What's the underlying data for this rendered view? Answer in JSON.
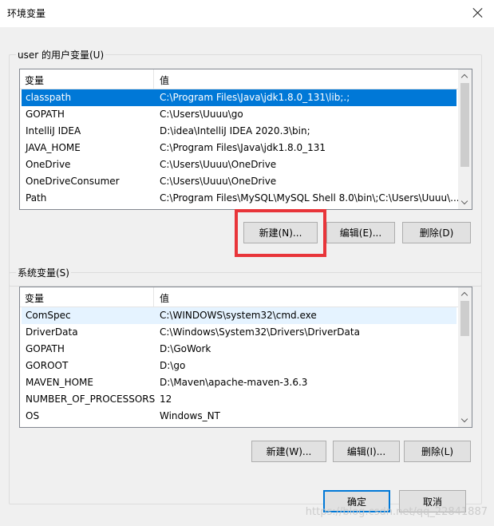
{
  "window": {
    "title": "环境变量"
  },
  "user_section": {
    "label": "user 的用户变量(U)",
    "columns": [
      "变量",
      "值"
    ],
    "rows": [
      {
        "name": "classpath",
        "value": "C:\\Program Files\\Java\\jdk1.8.0_131\\lib;.;",
        "selected": true
      },
      {
        "name": "GOPATH",
        "value": "C:\\Users\\Uuuu\\go"
      },
      {
        "name": "IntelliJ IDEA",
        "value": "D:\\idea\\IntelliJ IDEA 2020.3\\bin;"
      },
      {
        "name": "JAVA_HOME",
        "value": "C:\\Program Files\\Java\\jdk1.8.0_131"
      },
      {
        "name": "OneDrive",
        "value": "C:\\Users\\Uuuu\\OneDrive"
      },
      {
        "name": "OneDriveConsumer",
        "value": "C:\\Users\\Uuuu\\OneDrive"
      },
      {
        "name": "Path",
        "value": "C:\\Program Files\\MySQL\\MySQL Shell 8.0\\bin\\;C:\\Users\\Uuuu\\..."
      }
    ],
    "buttons": {
      "new": "新建(N)...",
      "edit": "编辑(E)...",
      "delete": "删除(D)"
    }
  },
  "system_section": {
    "label": "系统变量(S)",
    "columns": [
      "变量",
      "值"
    ],
    "rows": [
      {
        "name": "ComSpec",
        "value": "C:\\WINDOWS\\system32\\cmd.exe",
        "hover": true
      },
      {
        "name": "DriverData",
        "value": "C:\\Windows\\System32\\Drivers\\DriverData"
      },
      {
        "name": "GOPATH",
        "value": "D:\\GoWork"
      },
      {
        "name": "GOROOT",
        "value": "D:\\go"
      },
      {
        "name": "MAVEN_HOME",
        "value": "D:\\Maven\\apache-maven-3.6.3"
      },
      {
        "name": "NUMBER_OF_PROCESSORS",
        "value": "12"
      },
      {
        "name": "OS",
        "value": "Windows_NT"
      }
    ],
    "buttons": {
      "new": "新建(W)...",
      "edit": "编辑(I)...",
      "delete": "删除(L)"
    }
  },
  "footer": {
    "ok": "确定",
    "cancel": "取消"
  },
  "watermark": "https://blog.csdn.net/qq_22841887",
  "colors": {
    "selection": "#0078d7",
    "annotation_box": "#e8353a",
    "dialog_bg": "#f0f0f0"
  }
}
